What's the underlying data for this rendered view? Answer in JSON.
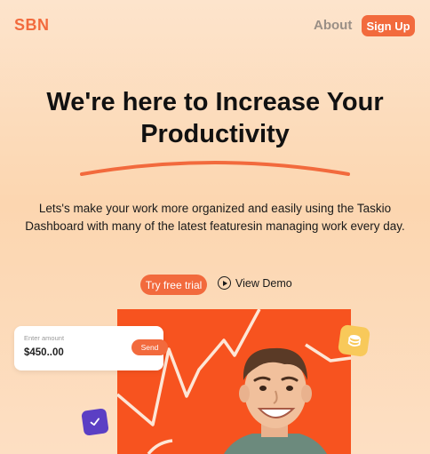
{
  "header": {
    "logo": "SBN",
    "about_label": "About",
    "signup_label": "Sign Up"
  },
  "hero": {
    "title": "We're here to Increase Your Productivity",
    "subtitle": "Lets's make your work more organized and easily using the Taskio Dashboard with many of the latest featuresin managing work every day.",
    "trial_label": "Try free trial",
    "demo_label": "View Demo"
  },
  "amount_card": {
    "label": "Enter amount",
    "value": "$450..00",
    "send_label": "Send"
  },
  "colors": {
    "accent": "#f26a3d",
    "panel": "#f7531f",
    "coin": "#f8c95a",
    "check": "#5b3fc4"
  },
  "icons": [
    "play-circle-icon",
    "coin-stack-icon",
    "checkmark-icon"
  ]
}
